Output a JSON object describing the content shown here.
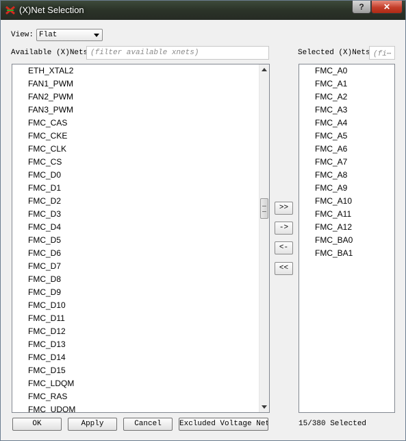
{
  "window": {
    "title": "(X)Net Selection",
    "help_label": "?",
    "close_label": "✕"
  },
  "view": {
    "label": "View:",
    "selected": "Flat"
  },
  "available": {
    "label": "Available (X)Nets",
    "filter_placeholder": "(filter available xnets)",
    "items": [
      "ETH_XTAL2",
      "FAN1_PWM",
      "FAN2_PWM",
      "FAN3_PWM",
      "FMC_CAS",
      "FMC_CKE",
      "FMC_CLK",
      "FMC_CS",
      "FMC_D0",
      "FMC_D1",
      "FMC_D2",
      "FMC_D3",
      "FMC_D4",
      "FMC_D5",
      "FMC_D6",
      "FMC_D7",
      "FMC_D8",
      "FMC_D9",
      "FMC_D10",
      "FMC_D11",
      "FMC_D12",
      "FMC_D13",
      "FMC_D14",
      "FMC_D15",
      "FMC_LDQM",
      "FMC_RAS",
      "FMC_UDQM"
    ]
  },
  "selected": {
    "label": "Selected (X)Nets",
    "filter_placeholder": "(fi⋯",
    "items": [
      "FMC_A0",
      "FMC_A1",
      "FMC_A2",
      "FMC_A3",
      "FMC_A4",
      "FMC_A5",
      "FMC_A6",
      "FMC_A7",
      "FMC_A8",
      "FMC_A9",
      "FMC_A10",
      "FMC_A11",
      "FMC_A12",
      "FMC_BA0",
      "FMC_BA1"
    ]
  },
  "move_buttons": {
    "add_all": ">>",
    "add": "->",
    "remove": "<-",
    "remove_all": "<<"
  },
  "buttons": {
    "ok": "OK",
    "apply": "Apply",
    "cancel": "Cancel",
    "excluded": "Excluded Voltage Nets"
  },
  "status": "15/380 Selected",
  "icons": {
    "app": "net-selection-icon",
    "list_scroll_up": "scroll-up-arrow-icon",
    "list_scroll_down": "scroll-down-arrow-icon"
  }
}
